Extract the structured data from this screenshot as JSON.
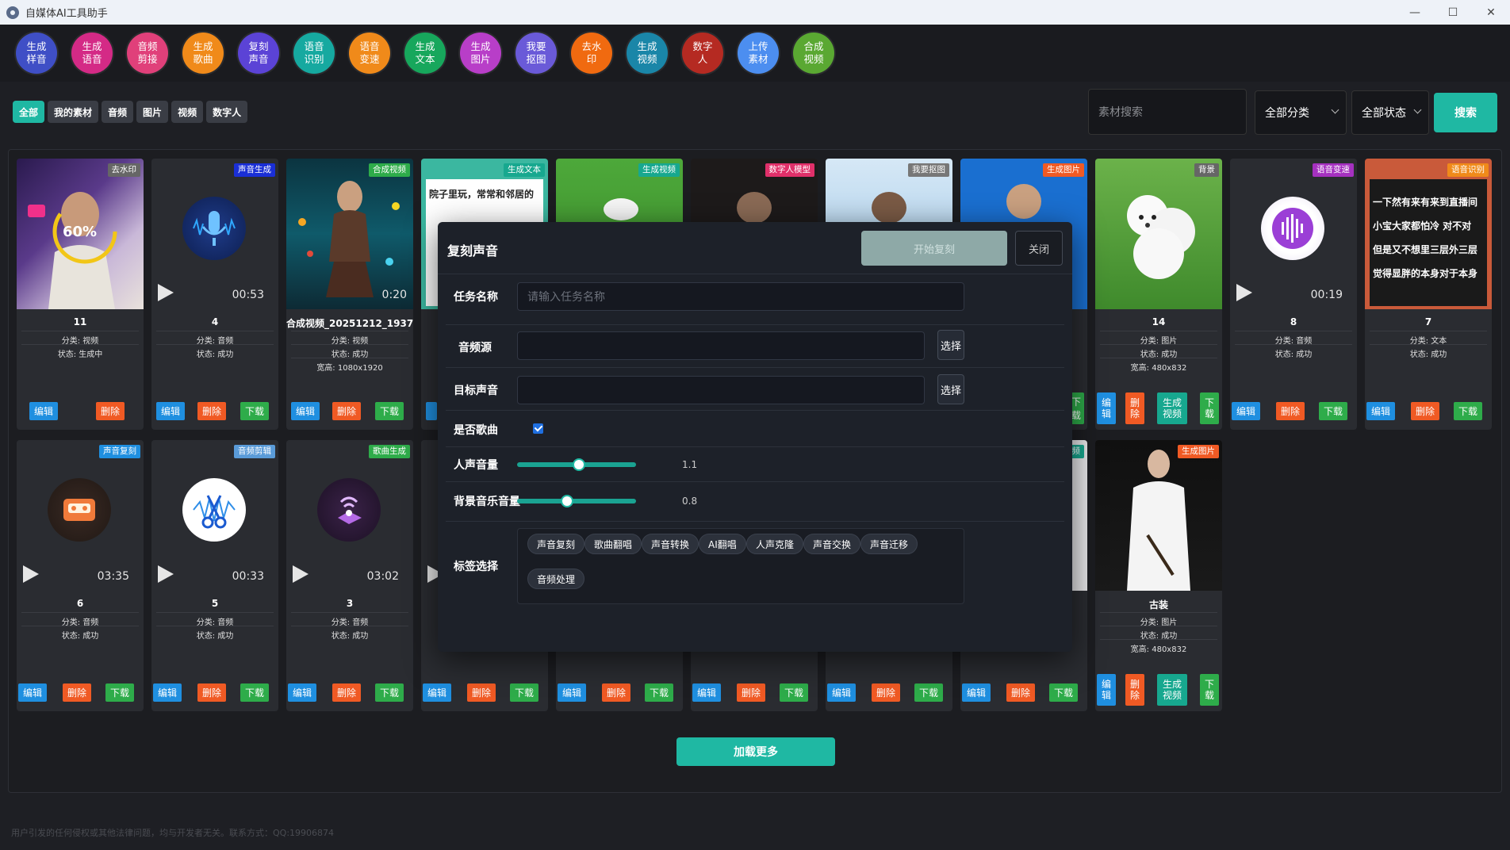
{
  "window": {
    "title": "自媒体AI工具助手",
    "minimize": "—",
    "maximize": "☐",
    "close": "✕"
  },
  "tools": [
    {
      "label": "生成样音",
      "l1": "生成",
      "l2": "样音",
      "color": "#3f4fc6"
    },
    {
      "label": "生成语音",
      "l1": "生成",
      "l2": "语音",
      "color": "#d42a86"
    },
    {
      "label": "音频剪接",
      "l1": "音频",
      "l2": "剪接",
      "color": "#e0407a"
    },
    {
      "label": "生成歌曲",
      "l1": "生成",
      "l2": "歌曲",
      "color": "#f08a1a"
    },
    {
      "label": "复刻声音",
      "l1": "复刻",
      "l2": "声音",
      "color": "#5b43d6"
    },
    {
      "label": "语音识别",
      "l1": "语音",
      "l2": "识别",
      "color": "#16a9a0"
    },
    {
      "label": "语音变速",
      "l1": "语音",
      "l2": "变速",
      "color": "#f08a1a"
    },
    {
      "label": "生成文本",
      "l1": "生成",
      "l2": "文本",
      "color": "#17a75c"
    },
    {
      "label": "生成图片",
      "l1": "生成",
      "l2": "图片",
      "color": "#b83ec8"
    },
    {
      "label": "我要抠图",
      "l1": "我要",
      "l2": "抠图",
      "color": "#6a5ad8"
    },
    {
      "label": "去水印",
      "l1": "去水",
      "l2": "印",
      "color": "#f06a10"
    },
    {
      "label": "生成视频",
      "l1": "生成",
      "l2": "视频",
      "color": "#1a86a8"
    },
    {
      "label": "数字人",
      "l1": "数字",
      "l2": "人",
      "color": "#b52a22"
    },
    {
      "label": "上传素材",
      "l1": "上传",
      "l2": "素材",
      "color": "#4c8ef0"
    },
    {
      "label": "合成视频",
      "l1": "合成",
      "l2": "视频",
      "color": "#5aa832"
    }
  ],
  "filters": [
    "全部",
    "我的素材",
    "音频",
    "图片",
    "视频",
    "数字人"
  ],
  "search": {
    "placeholder": "素材搜索",
    "category": "全部分类",
    "status": "全部状态",
    "button": "搜索"
  },
  "labels": {
    "edit": "编辑",
    "delete": "删除",
    "download": "下载",
    "gen_video": "生成视频",
    "edit_v": "编\n辑",
    "delete_v": "删\n除",
    "gen_video_v": "生成\n视频",
    "download_v": "下\n载"
  },
  "cards_row1": [
    {
      "badge": "去水印",
      "badge_color": "#666",
      "name": "11",
      "cat": "分类: 视频",
      "status": "状态: 生成中",
      "progress": "60%"
    },
    {
      "badge": "声音生成",
      "badge_color": "#1a2fd6",
      "name": "4",
      "cat": "分类: 音频",
      "status": "状态: 成功",
      "duration": "00:53"
    },
    {
      "badge": "合成视频",
      "badge_color": "#2eac4a",
      "name": "合成视频_20251212_1937",
      "cat": "分类: 视频",
      "status": "状态: 成功",
      "size": "宽高: 1080x1920",
      "duration": "0:20"
    },
    {
      "badge": "生成文本",
      "badge_color": "#17a88f",
      "text": "院子里玩，常常和邻居的"
    },
    {
      "badge": "生成视频",
      "badge_color": "#17a88f"
    },
    {
      "badge": "数字人模型",
      "badge_color": "#e0306a"
    },
    {
      "badge": "我要抠图",
      "badge_color": "#777"
    },
    {
      "badge": "生成图片",
      "badge_color": "#f05a24"
    },
    {
      "badge": "背景",
      "badge_color": "#666",
      "name": "14",
      "cat": "分类: 图片",
      "status": "状态: 成功",
      "size": "宽高: 480x832"
    },
    {
      "badge": "语音变速",
      "badge_color": "#a531c0",
      "name": "8",
      "cat": "分类: 音频",
      "status": "状态: 成功",
      "duration": "00:19"
    },
    {
      "badge": "语音识别",
      "badge_color": "#f08a1a",
      "name": "7",
      "cat": "分类: 文本",
      "status": "状态: 成功",
      "lines": [
        "一下然有来有来到直播间",
        "小宝大家都怕冷 对不对",
        "但是又不想里三层外三层",
        "觉得显胖的本身对于本身"
      ]
    }
  ],
  "cards_row2": [
    {
      "badge": "声音复刻",
      "badge_color": "#1f8fe0",
      "name": "6",
      "cat": "分类: 音频",
      "status": "状态: 成功",
      "duration": "03:35"
    },
    {
      "badge": "音频剪辑",
      "badge_color": "#5a9bd8",
      "name": "5",
      "cat": "分类: 音频",
      "status": "状态: 成功",
      "duration": "00:33"
    },
    {
      "badge": "歌曲生成",
      "badge_color": "#2eac4a",
      "name": "3",
      "cat": "分类: 音频",
      "status": "状态: 成功",
      "duration": "03:02"
    },
    {
      "badge": "频",
      "badge_color": "#17a88f"
    },
    {
      "badge": "生成图片",
      "badge_color": "#f05a24",
      "name": "古装",
      "cat": "分类: 图片",
      "status": "状态: 成功",
      "size": "宽高: 480x832"
    }
  ],
  "load_more": "加载更多",
  "footer": "用户引发的任何侵权或其他法律问题，均与开发者无关。联系方式：QQ:19906874",
  "modal": {
    "title": "复刻声音",
    "start": "开始复刻",
    "close": "关闭",
    "task_label": "任务名称",
    "task_placeholder": "请输入任务名称",
    "audio_label": "音频源",
    "target_label": "目标声音",
    "choose": "选择",
    "song_label": "是否歌曲",
    "vocal_label": "人声音量",
    "vocal_value": "1.1",
    "bgm_label": "背景音乐音量",
    "bgm_value": "0.8",
    "tags_label": "标签选择",
    "tags": [
      "声音复刻",
      "歌曲翻唱",
      "声音转换",
      "AI翻唱",
      "人声克隆",
      "声音交换",
      "声音迁移",
      "音频处理"
    ]
  }
}
